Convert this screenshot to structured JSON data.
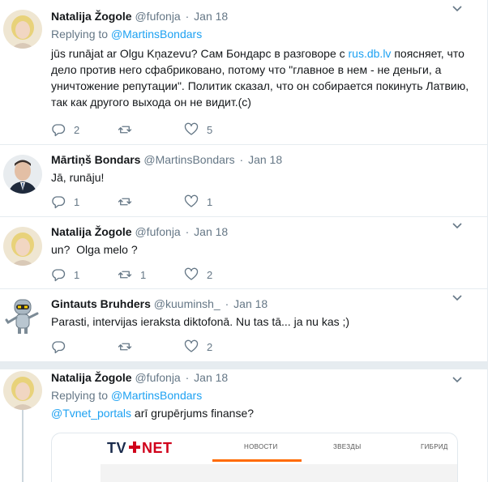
{
  "tweets": [
    {
      "name": "Natalija Žogole",
      "handle": "@fufonja",
      "time": "Jan 18",
      "replying_label": "Replying to",
      "replying_to": "@MartinsBondars",
      "text_before_link": "jūs runājat ar Olgu Kņazevu? Сам Бондарс в разговоре с ",
      "link": "rus.db.lv",
      "text_after_link": " поясняет, что дело против него сфабриковано, потому что \"главное в нем - не деньги, а уничтожение репутации\". Политик сказал, что он собирается покинуть Латвию, так как другого выхода он не видит.(с)",
      "replies": "2",
      "retweets": "",
      "likes": "5"
    },
    {
      "name": "Mārtiņš Bondars",
      "handle": "@MartinsBondars",
      "time": "Jan 18",
      "text": "Jā, runāju!",
      "replies": "1",
      "retweets": "",
      "likes": "1"
    },
    {
      "name": "Natalija Žogole",
      "handle": "@fufonja",
      "time": "Jan 18",
      "text": "un?  Olga melo ?",
      "replies": "1",
      "retweets": "1",
      "likes": "2"
    },
    {
      "name": "Gintauts Bruhders",
      "handle": "@kuuminsh_",
      "time": "Jan 18",
      "text": "Parasti, intervijas ieraksta diktofonā. Nu tas tā... ja nu kas ;)",
      "replies": "",
      "retweets": "",
      "likes": "2"
    },
    {
      "name": "Natalija Žogole",
      "handle": "@fufonja",
      "time": "Jan 18",
      "replying_label": "Replying to",
      "replying_to": "@MartinsBondars",
      "mention": "@Tvnet_portals",
      "text_after_mention": " arī grupērjums finanse?"
    }
  ],
  "dot": "·",
  "card": {
    "logo": "TV+NET",
    "nav": [
      "НОВОСТИ",
      "ЗВЕЗДЫ",
      "ГИБРИД"
    ]
  },
  "colors": {
    "accent": "#1da1f2",
    "muted": "#657786",
    "divider": "#e6ecf0",
    "logo_red": "#d0021b",
    "logo_dark": "#1a2b4c",
    "card_underline": "#ff6a00"
  }
}
